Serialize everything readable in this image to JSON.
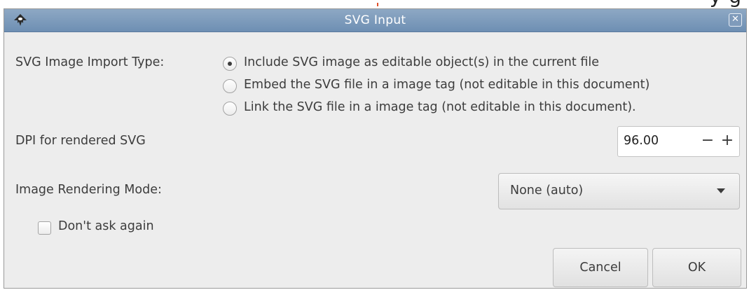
{
  "window": {
    "title": "SVG Input",
    "close_glyph": "✕",
    "app_icon": "inkscape-icon",
    "titlebar_color": "#7b99bb"
  },
  "import_type": {
    "label": "SVG Image Import Type:",
    "options": [
      {
        "label": "Include SVG image as editable object(s) in the current file",
        "selected": true
      },
      {
        "label": "Embed the SVG file in a image tag (not editable in this document)",
        "selected": false
      },
      {
        "label": "Link the SVG file in a image tag (not editable in this document).",
        "selected": false
      }
    ]
  },
  "dpi": {
    "label": "DPI for rendered SVG",
    "value": "96.00",
    "minus": "−",
    "plus": "+"
  },
  "rendering_mode": {
    "label": "Image Rendering Mode:",
    "selected": "None (auto)"
  },
  "dont_ask": {
    "label": "Don't ask again",
    "checked": false
  },
  "buttons": {
    "cancel": "Cancel",
    "ok": "OK"
  }
}
